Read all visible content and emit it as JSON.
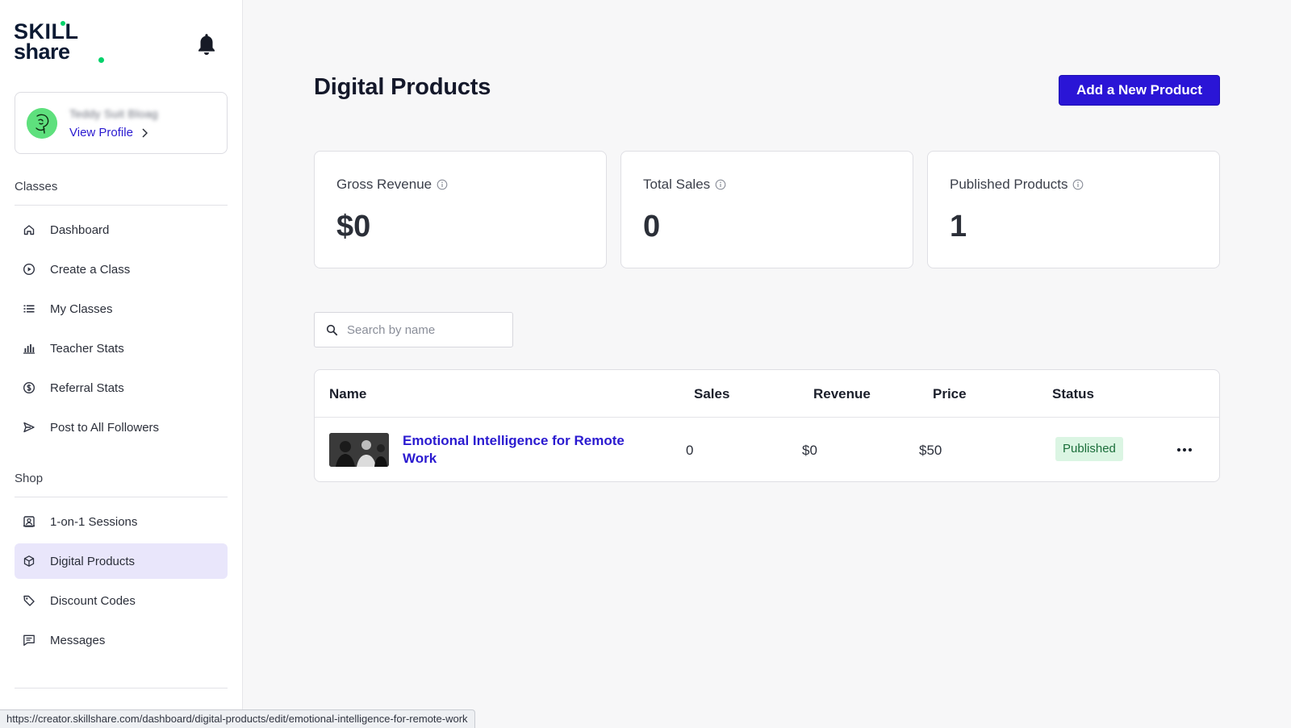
{
  "brand": {
    "logo_line1": "SKILL",
    "logo_line2": "share",
    "accent": "#00d26a",
    "primary": "#2a15d6"
  },
  "profile": {
    "name": "Teddy Suit Bloag",
    "view_profile": "View Profile"
  },
  "sidebar": {
    "sections": [
      {
        "label": "Classes",
        "items": [
          {
            "label": "Dashboard",
            "icon": "home-icon"
          },
          {
            "label": "Create a Class",
            "icon": "play-circle-icon"
          },
          {
            "label": "My Classes",
            "icon": "list-icon"
          },
          {
            "label": "Teacher Stats",
            "icon": "bar-chart-icon"
          },
          {
            "label": "Referral Stats",
            "icon": "dollar-circle-icon"
          },
          {
            "label": "Post to All Followers",
            "icon": "send-icon"
          }
        ]
      },
      {
        "label": "Shop",
        "items": [
          {
            "label": "1-on-1 Sessions",
            "icon": "person-card-icon"
          },
          {
            "label": "Digital Products",
            "icon": "box-icon",
            "active": true
          },
          {
            "label": "Discount Codes",
            "icon": "tag-icon"
          },
          {
            "label": "Messages",
            "icon": "message-icon"
          }
        ]
      }
    ]
  },
  "main": {
    "title": "Digital Products",
    "add_button": "Add a New Product",
    "stats": [
      {
        "label": "Gross Revenue",
        "value": "$0"
      },
      {
        "label": "Total Sales",
        "value": "0"
      },
      {
        "label": "Published Products",
        "value": "1"
      }
    ],
    "search": {
      "placeholder": "Search by name",
      "value": ""
    },
    "table": {
      "columns": [
        "Name",
        "Sales",
        "Revenue",
        "Price",
        "Status"
      ],
      "rows": [
        {
          "name": "Emotional Intelligence for Remote Work",
          "sales": "0",
          "revenue": "$0",
          "price": "$50",
          "status": "Published"
        }
      ]
    }
  },
  "status_bar": {
    "url": "https://creator.skillshare.com/dashboard/digital-products/edit/emotional-intelligence-for-remote-work"
  }
}
